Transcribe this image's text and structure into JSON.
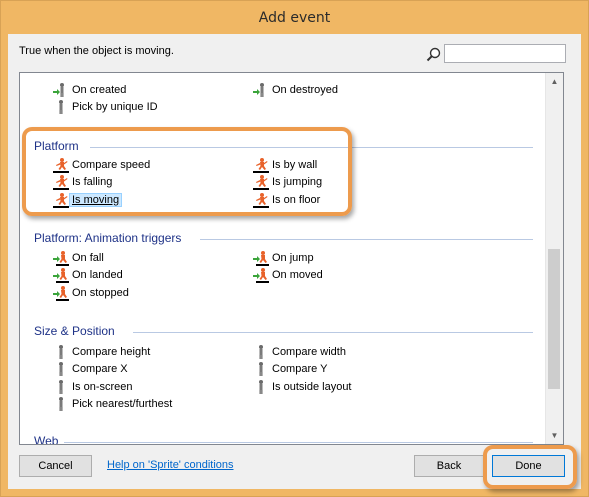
{
  "window": {
    "title": "Add event"
  },
  "description": "True when the object is moving.",
  "search": {
    "value": "",
    "placeholder": ""
  },
  "groups": [
    {
      "title": "",
      "items": [
        {
          "label": "On created",
          "icon": "arrow-trigger-icon"
        },
        {
          "label": "On destroyed",
          "icon": "arrow-trigger-icon"
        },
        {
          "label": "Pick by unique ID",
          "icon": "figure-icon"
        }
      ]
    },
    {
      "title": "Platform",
      "items": [
        {
          "label": "Compare speed",
          "icon": "platform-runner-icon"
        },
        {
          "label": "Is by wall",
          "icon": "platform-runner-icon"
        },
        {
          "label": "Is falling",
          "icon": "platform-runner-icon"
        },
        {
          "label": "Is jumping",
          "icon": "platform-runner-icon"
        },
        {
          "label": "Is moving",
          "icon": "platform-runner-icon",
          "selected": true
        },
        {
          "label": "Is on floor",
          "icon": "platform-runner-icon"
        }
      ]
    },
    {
      "title": "Platform: Animation triggers",
      "items": [
        {
          "label": "On fall",
          "icon": "platform-trigger-icon"
        },
        {
          "label": "On jump",
          "icon": "platform-trigger-icon"
        },
        {
          "label": "On landed",
          "icon": "platform-trigger-icon"
        },
        {
          "label": "On moved",
          "icon": "platform-trigger-icon"
        },
        {
          "label": "On stopped",
          "icon": "platform-trigger-icon"
        }
      ]
    },
    {
      "title": "Size & Position",
      "items": [
        {
          "label": "Compare height",
          "icon": "figure-icon"
        },
        {
          "label": "Compare width",
          "icon": "figure-icon"
        },
        {
          "label": "Compare X",
          "icon": "figure-icon"
        },
        {
          "label": "Compare Y",
          "icon": "figure-icon"
        },
        {
          "label": "Is on-screen",
          "icon": "figure-icon"
        },
        {
          "label": "Is outside layout",
          "icon": "figure-icon"
        },
        {
          "label": "Pick nearest/furthest",
          "icon": "figure-icon"
        }
      ]
    },
    {
      "title": "Web",
      "items": []
    }
  ],
  "buttons": {
    "cancel": "Cancel",
    "back": "Back",
    "done": "Done"
  },
  "help_link": "Help on 'Sprite' conditions",
  "colors": {
    "accent_orange": "#ed9b4d",
    "group_title": "#1e3287",
    "selection": "#cce8ff",
    "link": "#0066cc"
  }
}
